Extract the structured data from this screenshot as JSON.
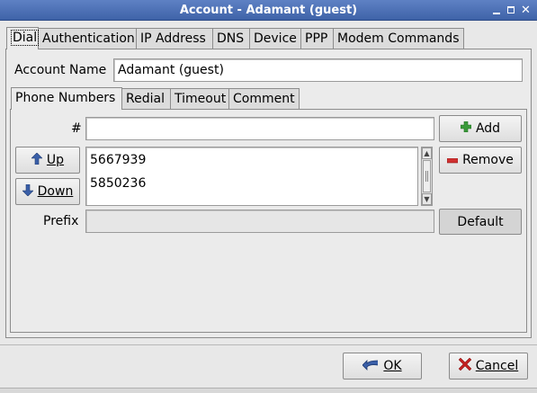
{
  "window": {
    "title": "Account - Adamant (guest)"
  },
  "tabs": [
    {
      "label": "Dial",
      "active": true
    },
    {
      "label": "Authentication",
      "active": false
    },
    {
      "label": "IP Address",
      "active": false
    },
    {
      "label": "DNS",
      "active": false
    },
    {
      "label": "Device",
      "active": false
    },
    {
      "label": "PPP",
      "active": false
    },
    {
      "label": "Modem Commands",
      "active": false
    }
  ],
  "account": {
    "label": "Account Name",
    "value": "Adamant (guest)"
  },
  "subtabs": [
    {
      "label": "Phone Numbers",
      "active": true
    },
    {
      "label": "Redial",
      "active": false
    },
    {
      "label": "Timeout",
      "active": false
    },
    {
      "label": "Comment",
      "active": false
    }
  ],
  "phone": {
    "number_label": "#",
    "number_value": "",
    "add_label": "Add",
    "remove_label": "Remove",
    "up_label": "Up",
    "down_label": "Down",
    "numbers": [
      "5667939",
      "5850236"
    ],
    "prefix_label": "Prefix",
    "prefix_value": "",
    "default_label": "Default"
  },
  "footer": {
    "ok_label": "OK",
    "cancel_label": "Cancel"
  },
  "icons": {
    "add": "plus-icon",
    "remove": "minus-icon",
    "up": "arrow-up-icon",
    "down": "arrow-down-icon",
    "ok": "check-icon",
    "cancel": "x-icon"
  },
  "colors": {
    "titlebar": "#4a6eb4",
    "add_icon": "#3a9a3a",
    "remove_icon": "#d03030",
    "arrow_icon": "#3a5fa8",
    "cancel_icon": "#c02020"
  }
}
